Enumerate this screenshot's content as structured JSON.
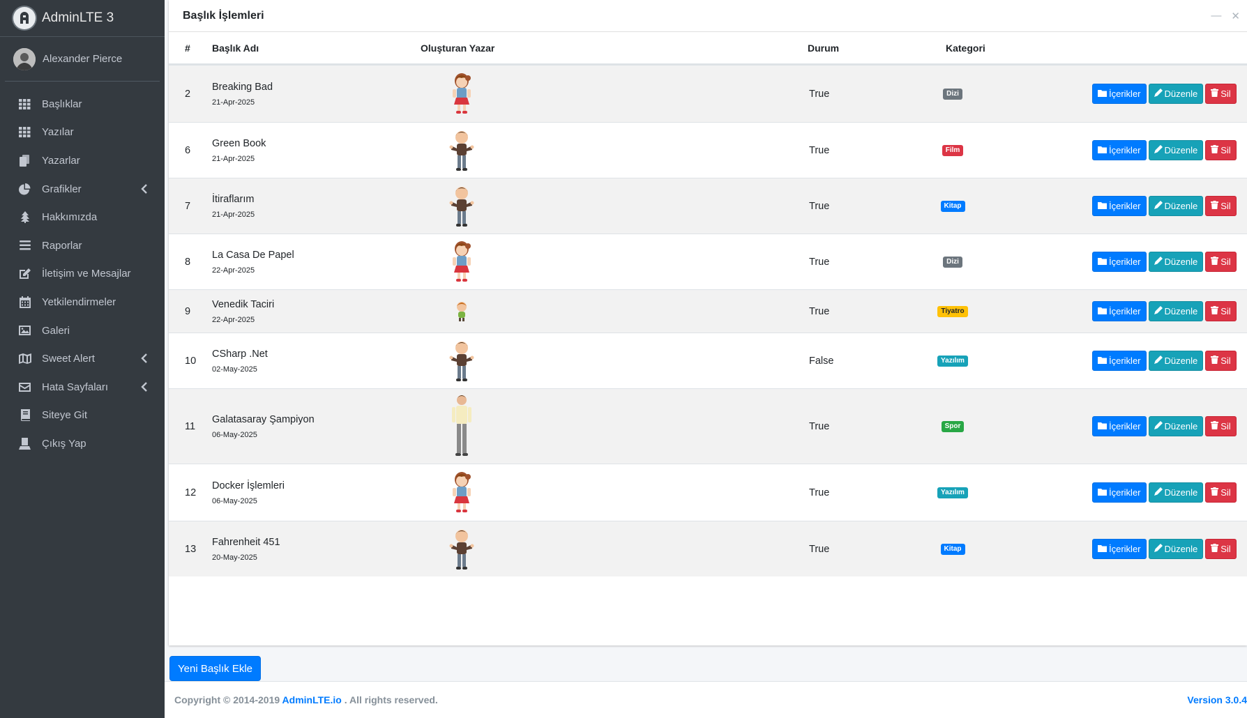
{
  "brand": {
    "title": "AdminLTE 3"
  },
  "user": {
    "name": "Alexander Pierce"
  },
  "nav": [
    {
      "label": "Başlıklar",
      "icon": "grid-icon",
      "caret": false
    },
    {
      "label": "Yazılar",
      "icon": "grid-icon",
      "caret": false
    },
    {
      "label": "Yazarlar",
      "icon": "copy-icon",
      "caret": false
    },
    {
      "label": "Grafikler",
      "icon": "pie-chart-icon",
      "caret": true
    },
    {
      "label": "Hakkımızda",
      "icon": "tree-icon",
      "caret": false
    },
    {
      "label": "Raporlar",
      "icon": "list-icon",
      "caret": false
    },
    {
      "label": "İletişim ve Mesajlar",
      "icon": "edit-icon",
      "caret": false
    },
    {
      "label": "Yetkilendirmeler",
      "icon": "calendar-icon",
      "caret": false
    },
    {
      "label": "Galeri",
      "icon": "image-icon",
      "caret": false
    },
    {
      "label": "Sweet Alert",
      "icon": "map-icon",
      "caret": true
    },
    {
      "label": "Hata Sayfaları",
      "icon": "envelope-icon",
      "caret": true
    },
    {
      "label": "Siteye Git",
      "icon": "book-icon",
      "caret": false
    },
    {
      "label": "Çıkış Yap",
      "icon": "user-icon",
      "caret": false
    }
  ],
  "card": {
    "title": "Başlık İşlemleri"
  },
  "table": {
    "headers": {
      "id": "#",
      "title": "Başlık Adı",
      "author": "Oluşturan Yazar",
      "status": "Durum",
      "category": "Kategori"
    },
    "actions": {
      "contents": "İçerikler",
      "edit": "Düzenle",
      "delete": "Sil"
    },
    "rows": [
      {
        "id": "2",
        "title": "Breaking Bad",
        "date": "21-Apr-2025",
        "avatar": "girl",
        "status": "True",
        "category": "Dizi",
        "cat_color": "#6c757d"
      },
      {
        "id": "6",
        "title": "Green Book",
        "date": "21-Apr-2025",
        "avatar": "boy",
        "status": "True",
        "category": "Film",
        "cat_color": "#dc3545"
      },
      {
        "id": "7",
        "title": "İtiraflarım",
        "date": "21-Apr-2025",
        "avatar": "boy",
        "status": "True",
        "category": "Kitap",
        "cat_color": "#007bff"
      },
      {
        "id": "8",
        "title": "La Casa De Papel",
        "date": "22-Apr-2025",
        "avatar": "girl",
        "status": "True",
        "category": "Dizi",
        "cat_color": "#6c757d"
      },
      {
        "id": "9",
        "title": "Venedik Taciri",
        "date": "22-Apr-2025",
        "avatar": "small",
        "status": "True",
        "category": "Tiyatro",
        "cat_color": "#ffc107"
      },
      {
        "id": "10",
        "title": "CSharp .Net",
        "date": "02-May-2025",
        "avatar": "boy",
        "status": "False",
        "category": "Yazılım",
        "cat_color": "#17a2b8"
      },
      {
        "id": "11",
        "title": "Galatasaray Şampiyon",
        "date": "06-May-2025",
        "avatar": "man",
        "status": "True",
        "category": "Spor",
        "cat_color": "#28a745"
      },
      {
        "id": "12",
        "title": "Docker İşlemleri",
        "date": "06-May-2025",
        "avatar": "girl",
        "status": "True",
        "category": "Yazılım",
        "cat_color": "#17a2b8"
      },
      {
        "id": "13",
        "title": "Fahrenheit 451",
        "date": "20-May-2025",
        "avatar": "boy",
        "status": "True",
        "category": "Kitap",
        "cat_color": "#007bff"
      }
    ]
  },
  "add_button": "Yeni Başlık Ekle",
  "footer": {
    "copy_prefix": "Copyright © 2014-2019 ",
    "copy_link": "AdminLTE.io",
    "copy_suffix": " . All rights reserved.",
    "version": "Version 3.0.4"
  }
}
